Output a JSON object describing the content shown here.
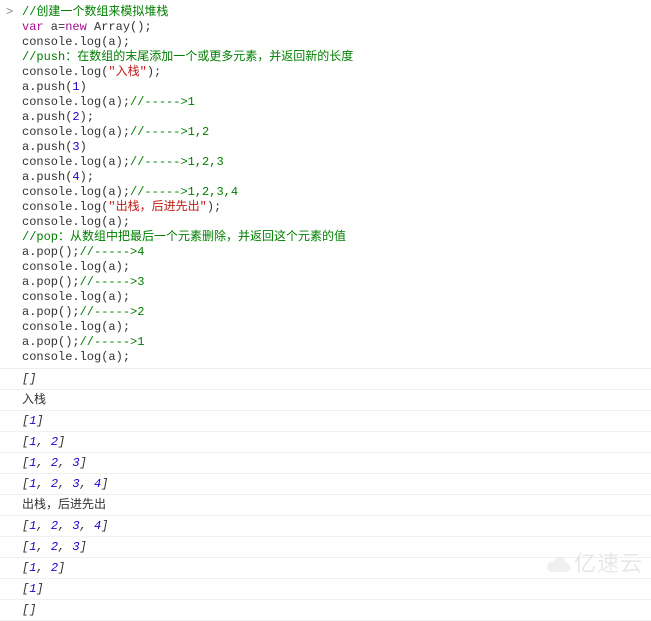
{
  "prompt": ">",
  "code": {
    "line1": "//创建一个数组来模拟堆栈",
    "line2_var": "var",
    "line2_mid": " a=",
    "line2_new": "new",
    "line2_rest": " Array();",
    "line3": "console.log(a);",
    "line4_a": "//push",
    "line4_b": "：在数组的末尾添加一个或更多元素，并返回新的长度",
    "line5_a": "console.log(",
    "line5_s": "\"入栈\"",
    "line5_b": ");",
    "line6_a": "a.push(",
    "line6_n": "1",
    "line6_b": ")",
    "line7_a": "console.log(a);",
    "line7_c": "//----->1",
    "line8_a": "a.push(",
    "line8_n": "2",
    "line8_b": ");",
    "line9_a": "console.log(a);",
    "line9_c": "//----->1,2",
    "line10_a": "a.push(",
    "line10_n": "3",
    "line10_b": ")",
    "line11_a": "console.log(a);",
    "line11_c": "//----->1,2,3",
    "line12_a": "a.push(",
    "line12_n": "4",
    "line12_b": ");",
    "line13_a": "console.log(a);",
    "line13_c": "//----->1,2,3,4",
    "line14_a": "console.log(",
    "line14_s": "\"出栈，后进先出\"",
    "line14_b": ");",
    "line15": "console.log(a);",
    "line16_a": "//pop",
    "line16_b": "：从数组中把最后一个元素删除，并返回这个元素的值",
    "line17_a": "a.pop();",
    "line17_c": "//----->4",
    "line18": "console.log(a);",
    "line19_a": "a.pop();",
    "line19_c": "//----->3",
    "line20": "console.log(a);",
    "line21_a": "a.pop();",
    "line21_c": "//----->2",
    "line22": "console.log(a);",
    "line23_a": "a.pop();",
    "line23_c": "//----->1",
    "line24": "console.log(a);"
  },
  "output": {
    "l1_open": "[",
    "l1_close": "]",
    "l2_text": "入栈",
    "l3_open": "[",
    "l3_v": "1",
    "l3_close": "]",
    "l4_open": "[",
    "l4_v1": "1",
    "l4_v2": "2",
    "l4_close": "]",
    "l5_open": "[",
    "l5_v1": "1",
    "l5_v2": "2",
    "l5_v3": "3",
    "l5_close": "]",
    "l6_open": "[",
    "l6_v1": "1",
    "l6_v2": "2",
    "l6_v3": "3",
    "l6_v4": "4",
    "l6_close": "]",
    "l7_text": "出栈，后进先出",
    "l8_open": "[",
    "l8_v1": "1",
    "l8_v2": "2",
    "l8_v3": "3",
    "l8_v4": "4",
    "l8_close": "]",
    "l9_open": "[",
    "l9_v1": "1",
    "l9_v2": "2",
    "l9_v3": "3",
    "l9_close": "]",
    "l10_open": "[",
    "l10_v1": "1",
    "l10_v2": "2",
    "l10_close": "]",
    "l11_open": "[",
    "l11_v": "1",
    "l11_close": "]",
    "l12_open": "[",
    "l12_close": "]",
    "sep": ", "
  },
  "watermark": "亿速云"
}
